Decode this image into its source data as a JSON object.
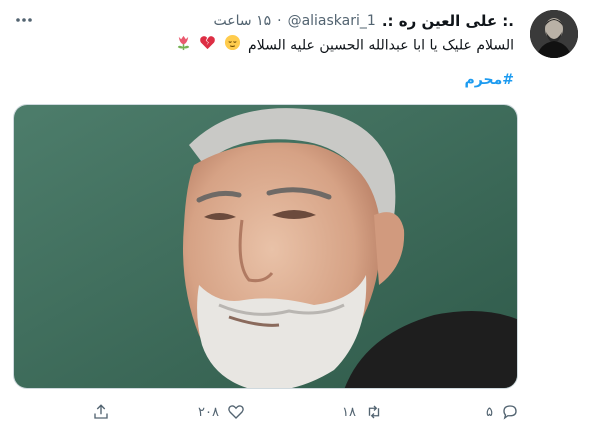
{
  "tweet": {
    "display_name": ".: علی العین ره :.",
    "handle": "@aliaskari_1",
    "separator": "·",
    "time": "۱۵ ساعت",
    "text": "السلام علیک یا ابا عبدالله الحسین علیه السلام",
    "text_emojis": [
      "relieved-face",
      "broken-heart",
      "tulip"
    ],
    "hashtag": "#محرم"
  },
  "actions": {
    "reply_count": "۵",
    "retweet_count": "۱۸",
    "like_count": "۲۰۸"
  },
  "colors": {
    "link": "#1d9bf0",
    "secondary_text": "#536471",
    "media_background": "#3f6e5c"
  }
}
